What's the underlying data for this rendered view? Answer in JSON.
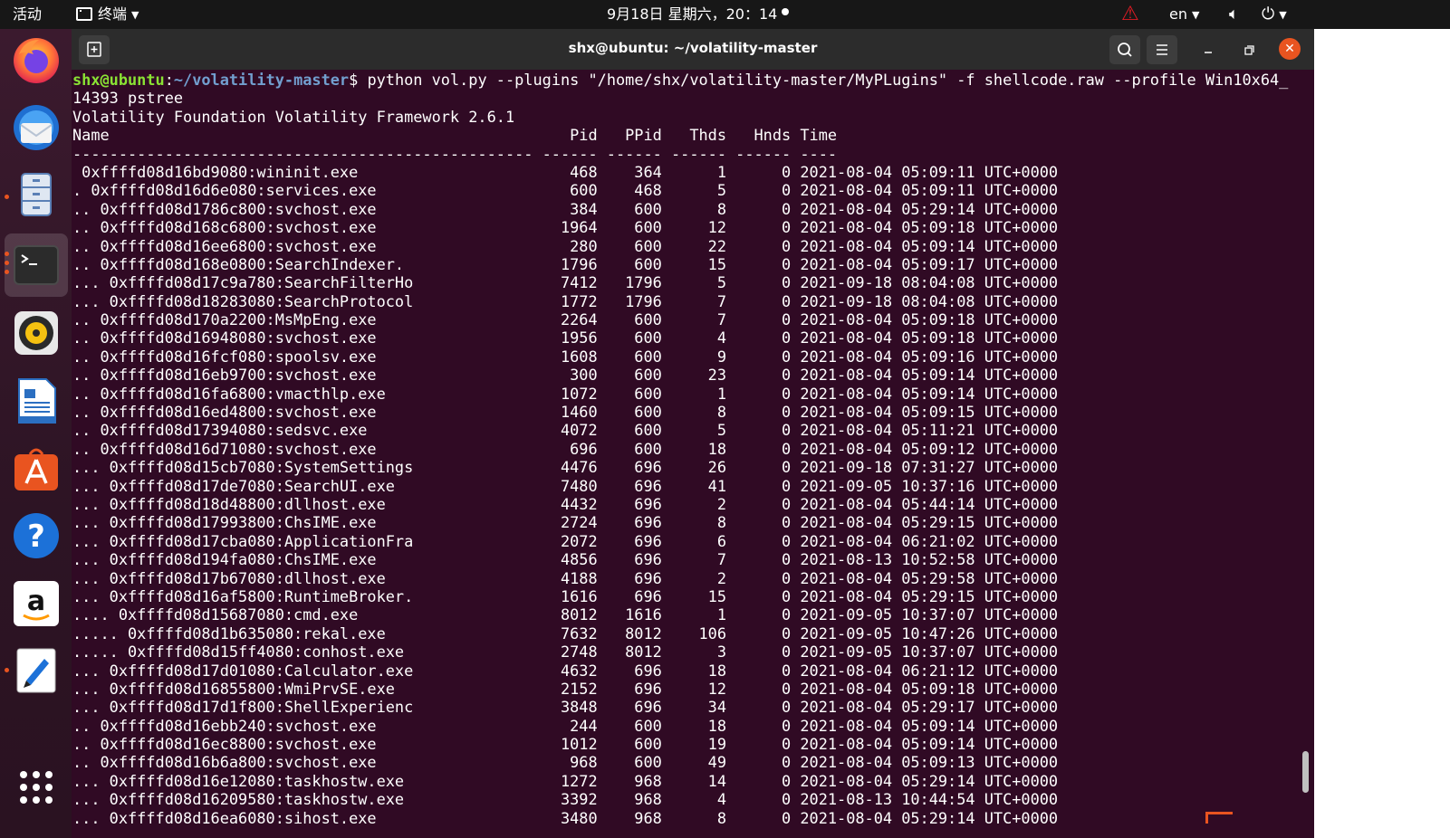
{
  "topbar": {
    "activities": "活动",
    "app_menu": "终端",
    "clock": "9月18日 星期六，20：14",
    "lang": "en",
    "icons": [
      "warning-icon",
      "volume-icon",
      "power-icon"
    ]
  },
  "dock": {
    "apps": [
      "Firefox",
      "Thunderbird",
      "Files",
      "Terminal",
      "Rhythmbox",
      "LibreOffice Writer",
      "Ubuntu Software",
      "Help",
      "Amazon",
      "Text Editor",
      "Show Applications"
    ]
  },
  "window": {
    "title": "shx@ubuntu: ~/volatility-master"
  },
  "terminal": {
    "prompt_user": "shx@ubuntu",
    "prompt_sep": ":",
    "prompt_path": "~/volatility-master",
    "prompt_sym": "$ ",
    "command": "python vol.py --plugins \"/home/shx/volatility-master/MyPLugins\" -f shellcode.raw --profile Win10x64_",
    "lines": [
      "14393 pstree",
      "Volatility Foundation Volatility Framework 2.6.1",
      "Name                                                  Pid   PPid   Thds   Hnds Time",
      "-------------------------------------------------- ------ ------ ------ ------ ----",
      " 0xffffd08d16bd9080:wininit.exe                       468    364      1      0 2021-08-04 05:09:11 UTC+0000",
      ". 0xffffd08d16d6e080:services.exe                     600    468      5      0 2021-08-04 05:09:11 UTC+0000",
      ".. 0xffffd08d1786c800:svchost.exe                     384    600      8      0 2021-08-04 05:29:14 UTC+0000",
      ".. 0xffffd08d168c6800:svchost.exe                    1964    600     12      0 2021-08-04 05:09:18 UTC+0000",
      ".. 0xffffd08d16ee6800:svchost.exe                     280    600     22      0 2021-08-04 05:09:14 UTC+0000",
      ".. 0xffffd08d168e0800:SearchIndexer.                 1796    600     15      0 2021-08-04 05:09:17 UTC+0000",
      "... 0xffffd08d17c9a780:SearchFilterHo                7412   1796      5      0 2021-09-18 08:04:08 UTC+0000",
      "... 0xffffd08d18283080:SearchProtocol                1772   1796      7      0 2021-09-18 08:04:08 UTC+0000",
      ".. 0xffffd08d170a2200:MsMpEng.exe                    2264    600      7      0 2021-08-04 05:09:18 UTC+0000",
      ".. 0xffffd08d16948080:svchost.exe                    1956    600      4      0 2021-08-04 05:09:18 UTC+0000",
      ".. 0xffffd08d16fcf080:spoolsv.exe                    1608    600      9      0 2021-08-04 05:09:16 UTC+0000",
      ".. 0xffffd08d16eb9700:svchost.exe                     300    600     23      0 2021-08-04 05:09:14 UTC+0000",
      ".. 0xffffd08d16fa6800:vmacthlp.exe                   1072    600      1      0 2021-08-04 05:09:14 UTC+0000",
      ".. 0xffffd08d16ed4800:svchost.exe                    1460    600      8      0 2021-08-04 05:09:15 UTC+0000",
      ".. 0xffffd08d17394080:sedsvc.exe                     4072    600      5      0 2021-08-04 05:11:21 UTC+0000",
      ".. 0xffffd08d16d71080:svchost.exe                     696    600     18      0 2021-08-04 05:09:12 UTC+0000",
      "... 0xffffd08d15cb7080:SystemSettings                4476    696     26      0 2021-09-18 07:31:27 UTC+0000",
      "... 0xffffd08d17de7080:SearchUI.exe                  7480    696     41      0 2021-09-05 10:37:16 UTC+0000",
      "... 0xffffd08d18d48800:dllhost.exe                   4432    696      2      0 2021-08-04 05:44:14 UTC+0000",
      "... 0xffffd08d17993800:ChsIME.exe                    2724    696      8      0 2021-08-04 05:29:15 UTC+0000",
      "... 0xffffd08d17cba080:ApplicationFra                2072    696      6      0 2021-08-04 06:21:02 UTC+0000",
      "... 0xffffd08d194fa080:ChsIME.exe                    4856    696      7      0 2021-08-13 10:52:58 UTC+0000",
      "... 0xffffd08d17b67080:dllhost.exe                   4188    696      2      0 2021-08-04 05:29:58 UTC+0000",
      "... 0xffffd08d16af5800:RuntimeBroker.                1616    696     15      0 2021-08-04 05:29:15 UTC+0000",
      ".... 0xffffd08d15687080:cmd.exe                      8012   1616      1      0 2021-09-05 10:37:07 UTC+0000",
      "..... 0xffffd08d1b635080:rekal.exe                   7632   8012    106      0 2021-09-05 10:47:26 UTC+0000",
      "..... 0xffffd08d15ff4080:conhost.exe                 2748   8012      3      0 2021-09-05 10:37:07 UTC+0000",
      "... 0xffffd08d17d01080:Calculator.exe                4632    696     18      0 2021-08-04 06:21:12 UTC+0000",
      "... 0xffffd08d16855800:WmiPrvSE.exe                  2152    696     12      0 2021-08-04 05:09:18 UTC+0000",
      "... 0xffffd08d17d1f800:ShellExperienc                3848    696     34      0 2021-08-04 05:29:17 UTC+0000",
      ".. 0xffffd08d16ebb240:svchost.exe                     244    600     18      0 2021-08-04 05:09:14 UTC+0000",
      ".. 0xffffd08d16ec8800:svchost.exe                    1012    600     19      0 2021-08-04 05:09:14 UTC+0000",
      ".. 0xffffd08d16b6a800:svchost.exe                     968    600     49      0 2021-08-04 05:09:13 UTC+0000",
      "... 0xffffd08d16e12080:taskhostw.exe                 1272    968     14      0 2021-08-04 05:29:14 UTC+0000",
      "... 0xffffd08d16209580:taskhostw.exe                 3392    968      4      0 2021-08-13 10:44:54 UTC+0000",
      "... 0xffffd08d16ea6080:sihost.exe                    3480    968      8      0 2021-08-04 05:29:14 UTC+0000"
    ]
  },
  "colors": {
    "terminal_bg": "#300a24",
    "prompt_user": "#8ae234",
    "prompt_path": "#729fcf",
    "accent": "#e95420"
  }
}
